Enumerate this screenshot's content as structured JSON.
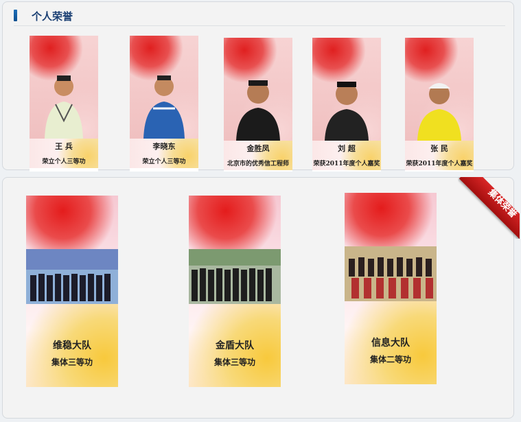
{
  "section": {
    "title": "个人荣誉"
  },
  "individuals": [
    {
      "name": "王 兵",
      "honor": "荣立个人三等功"
    },
    {
      "name": "李晓东",
      "honor": "荣立个人三等功"
    },
    {
      "name": "金胜凤",
      "honor": "北京市的优秀信工程师"
    },
    {
      "name": "刘 超",
      "honor": "荣获2011年度个人嘉奖"
    },
    {
      "name": "张 民",
      "honor": "荣获2011年度个人嘉奖"
    }
  ],
  "collective": {
    "ribbon": "集体荣誉",
    "items": [
      {
        "team": "维稳大队",
        "honor": "集体三等功"
      },
      {
        "team": "金盾大队",
        "honor": "集体三等功"
      },
      {
        "team": "信息大队",
        "honor": "集体二等功"
      }
    ]
  },
  "colors": {
    "accent": "#1a3f73",
    "ribbon": "#c41a1a"
  }
}
